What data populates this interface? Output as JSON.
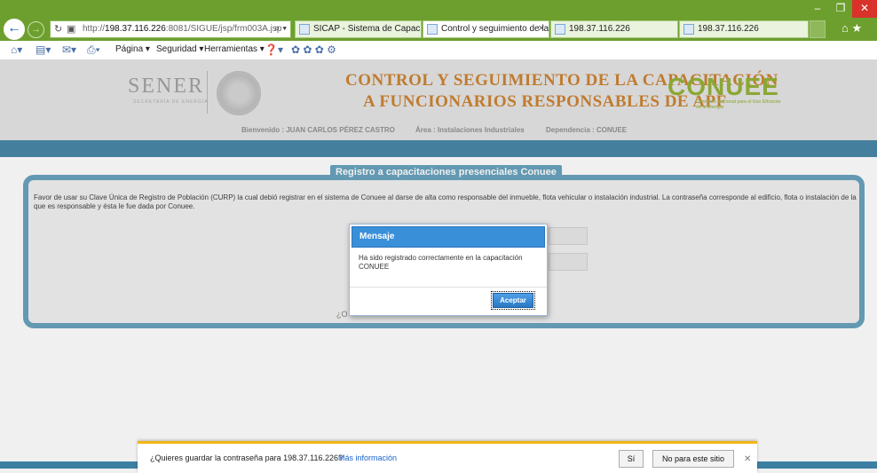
{
  "browser": {
    "address": {
      "prefix": "http://",
      "host": "198.37.116.226",
      "rest": ":8081/SIGUE/jsp/frm003A.jsp"
    },
    "tabs": [
      {
        "label": "SICAP - Sistema de Capacitación"
      },
      {
        "label": "Control y seguimiento de la..."
      },
      {
        "label": "198.37.116.226"
      },
      {
        "label": "198.37.116.226"
      }
    ],
    "command_bar": {
      "pagina": "Página ▾",
      "seguridad": "Seguridad ▾",
      "herramientas": "Herramientas ▾"
    }
  },
  "header": {
    "sener": "SENER",
    "sener_sub": "SECRETARÍA DE ENERGÍA",
    "title_line1": "CONTROL Y SEGUIMIENTO DE LA CAPACITACIÓN",
    "title_line2": "A FUNCIONARIOS RESPONSABLES DE APF",
    "conuee": "CONUEE",
    "conuee_sub": "Comisión Nacional para el Uso Eficiente de la Energía",
    "welcome": "Bienvenido : JUAN CARLOS PÉREZ CASTRO",
    "area": "Área : Instalaciones Industriales",
    "dependencia": "Dependencia : CONUEE"
  },
  "panel": {
    "legend": "Registro a capacitaciones presenciales Conuee",
    "instructions": "Favor de usar su Clave Única de Registro de Población (CURP) la cual debió registrar en el sistema de Conuee al darse de alta como responsable del inmueble, flota vehicular o instalación industrial. La contraseña corresponde al edificio, flota o instalación de la que es responsable y ésta le fue dada por Conuee.",
    "partial_link": "¿O"
  },
  "modal": {
    "title": "Mensaje",
    "message": "Ha sido registrado correctamente en la capacitación CONUEE",
    "ok": "Aceptar"
  },
  "notification": {
    "message": "¿Quieres guardar la contraseña para 198.37.116.226?",
    "more": "Más información",
    "yes": "Sí",
    "no": "No para este sitio"
  },
  "colors": {
    "chrome": "#6d9f2e",
    "band": "#3d7fa2",
    "panel_border": "#5f9db9",
    "title": "#c97a24",
    "modal_header": "#3a8fd9",
    "notif_accent": "#f1b514"
  }
}
